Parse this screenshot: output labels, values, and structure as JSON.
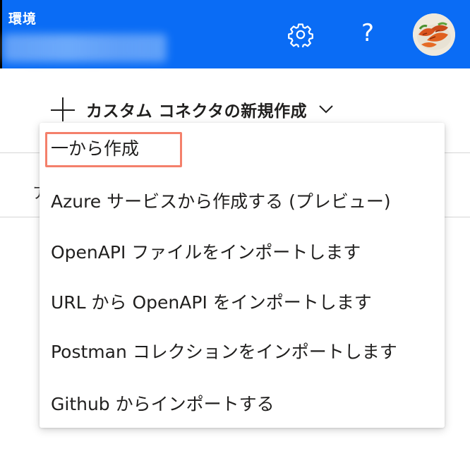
{
  "header": {
    "environment_label": "環境",
    "environment_name": "",
    "accent_color": "#0a6cf5",
    "icons": [
      "gear-icon",
      "help-icon",
      "avatar"
    ],
    "help_glyph": "?"
  },
  "toolbar": {
    "new_connector_label": "カスタム コネクタの新規作成"
  },
  "tabs": {
    "partial_label": "ア"
  },
  "dropdown_menu": {
    "items": [
      {
        "label": "一から作成",
        "highlighted": true
      },
      {
        "label": "Azure サービスから作成する (プレビュー)"
      },
      {
        "label": "OpenAPI ファイルをインポートします"
      },
      {
        "label": "URL から OpenAPI をインポートします"
      },
      {
        "label": "Postman コレクションをインポートします"
      },
      {
        "label": "Github からインポートする"
      }
    ],
    "highlight_color": "#f4806b"
  }
}
